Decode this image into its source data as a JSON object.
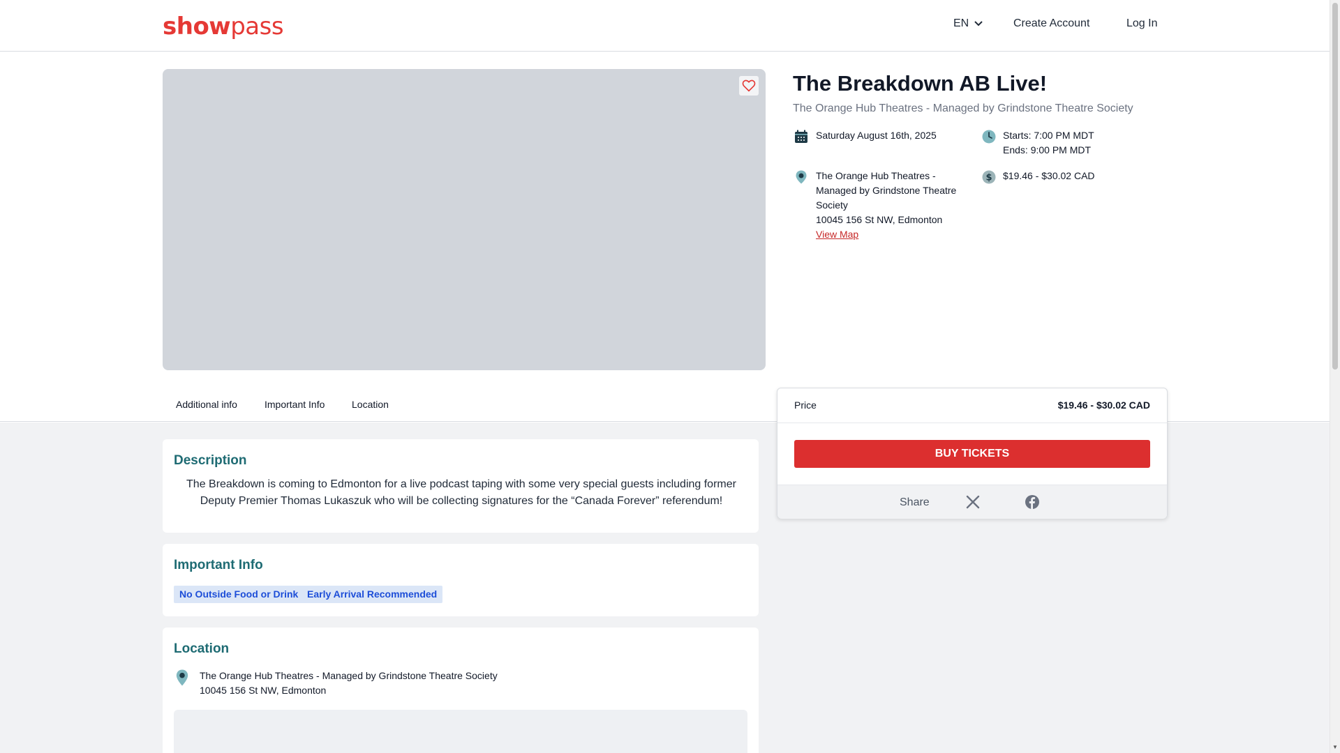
{
  "header": {
    "logo_part1": "show",
    "logo_part2": "pass",
    "language": "EN",
    "create_account": "Create Account",
    "log_in": "Log In"
  },
  "event": {
    "title": "The Breakdown AB Live!",
    "subtitle": "The Orange Hub Theatres - Managed by Grindstone Theatre Society",
    "date": "Saturday August 16th, 2025",
    "starts": "Starts: 7:00 PM MDT",
    "ends": "Ends: 9:00 PM MDT",
    "venue_line1": "The Orange Hub Theatres -",
    "venue_line2": "Managed by Grindstone Theatre",
    "venue_line3": "Society",
    "address": "10045 156 St NW, Edmonton",
    "view_map": "View Map",
    "price_range": "$19.46 - $30.02 CAD"
  },
  "tabs": [
    "Additional info",
    "Important Info",
    "Location"
  ],
  "description": {
    "heading": "Description",
    "text": "The Breakdown is coming to Edmonton for a live podcast taping with some very special guests including former Deputy Premier Thomas Lukaszuk who will be collecting signatures for the “Canada Forever” referendum!"
  },
  "important_info": {
    "heading": "Important Info",
    "tags": [
      "No Outside Food or Drink",
      "Early Arrival Recommended"
    ]
  },
  "location": {
    "heading": "Location",
    "venue": "The Orange Hub Theatres - Managed by Grindstone Theatre Society",
    "address": "10045 156 St NW, Edmonton"
  },
  "ticket": {
    "price_label": "Price",
    "price_value": "$19.46 - $30.02 CAD",
    "buy_label": "BUY TICKETS",
    "share_label": "Share"
  },
  "colors": {
    "brand": "#e53935",
    "buy_button": "#dc2f2f",
    "heading_teal": "#1e6b73",
    "tag_bg": "#dbe6f7",
    "tag_text": "#1d4ed8",
    "icon_teal": "#7fb7bf",
    "icon_dark": "#1e3a46"
  }
}
